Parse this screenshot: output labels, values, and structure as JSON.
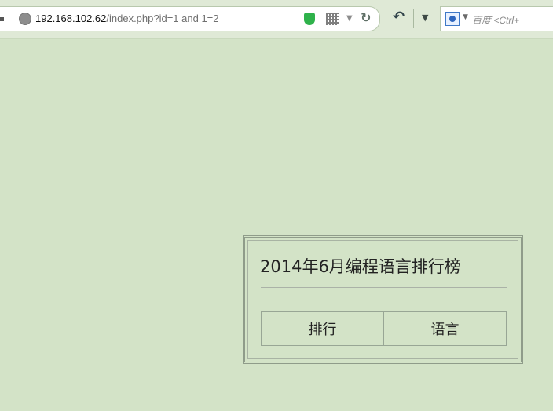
{
  "browser": {
    "url_host": "192.168.102.62",
    "url_path": "/index.php?id=1 and 1=2",
    "search_placeholder": "百度 <Ctrl+",
    "icons": {
      "site": "globe-icon",
      "security": "shield-icon",
      "qr": "qr-code-icon",
      "dropdown": "dropdown-icon",
      "refresh": "refresh-icon",
      "back": "back-icon",
      "search_engine": "baidu-paw-icon"
    },
    "colors": {
      "page_background": "#d3e3c7",
      "shield": "#2fb24b"
    }
  },
  "ranking": {
    "title": "2014年6月编程语言排行榜",
    "columns": [
      "排行",
      "语言"
    ]
  }
}
